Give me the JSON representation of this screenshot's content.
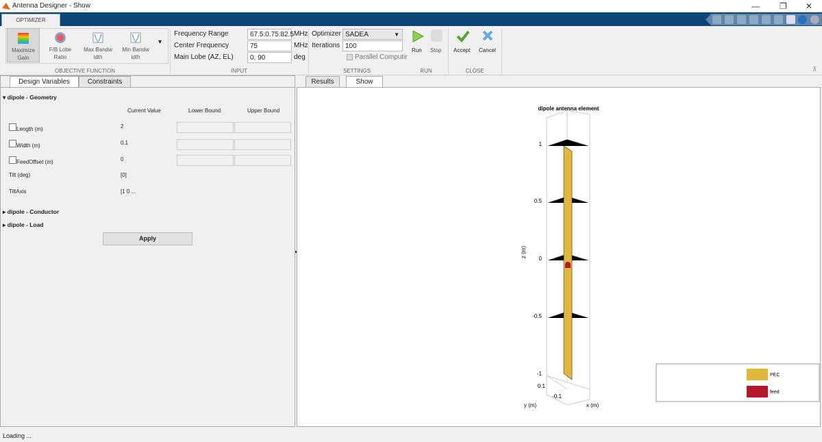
{
  "window": {
    "title": "Antenna Designer - Show",
    "minimize": "—",
    "restore": "❐",
    "close": "✕"
  },
  "ribbon": {
    "tab": "OPTIMIZER",
    "objective": {
      "label": "OBJECTIVE FUNCTION",
      "buttons": [
        {
          "l1": "Maximize",
          "l2": "Gain"
        },
        {
          "l1": "F/B Lobe",
          "l2": "Ratio"
        },
        {
          "l1": "Max Bandw",
          "l2": "idth"
        },
        {
          "l1": "Min Bandw",
          "l2": "idth"
        }
      ],
      "more": "▾"
    },
    "input": {
      "label": "INPUT",
      "freq_range_label": "Frequency Range",
      "freq_range": "67.5:0.75:82.5",
      "freq_unit": "MHz",
      "center_label": "Center Frequency",
      "center": "75",
      "center_unit": "MHz",
      "lobe_label": "Main Lobe (AZ, EL)",
      "lobe": "0, 90",
      "lobe_unit": "deg"
    },
    "settings": {
      "label": "SETTINGS",
      "optimizer_label": "Optimizer",
      "optimizer": "SADEA",
      "iterations_label": "Iterations",
      "iterations": "100",
      "parallel": "Parallel Computir"
    },
    "run": {
      "label": "RUN",
      "run": "Run",
      "stop": "Stop"
    },
    "close": {
      "label": "CLOSE",
      "accept": "Accept",
      "cancel": "Cancel"
    }
  },
  "left": {
    "tabs": [
      "Design Variables",
      "Constraints"
    ],
    "geometry": "dipole - Geometry",
    "cols": [
      "Current Value",
      "Lower Bound",
      "Upper Bound"
    ],
    "rows": [
      {
        "name": "Length (m)",
        "value": "2"
      },
      {
        "name": "Width (m)",
        "value": "0.1"
      },
      {
        "name": "FeedOffset (m)",
        "value": "0"
      }
    ],
    "fixed": [
      {
        "name": "Tilt (deg)",
        "value": "[0]"
      },
      {
        "name": "TiltAxis",
        "value": "[1  0 ..."
      }
    ],
    "conductor": "dipole - Conductor",
    "load": "dipole - Load",
    "apply": "Apply"
  },
  "right": {
    "tabs": [
      "Results",
      "Show"
    ],
    "plot": {
      "title": "dipole antenna element",
      "zlabel": "z (m)",
      "ylabel": "y (m)",
      "xlabel": "x (m)",
      "zticks": [
        "1",
        "0.5",
        "0",
        "-0.5",
        "-1"
      ],
      "yticks": [
        "0.1",
        "-0.1"
      ],
      "legend": [
        {
          "label": "PEC",
          "color": "#dfb83c"
        },
        {
          "label": "feed",
          "color": "#b5162c"
        }
      ]
    }
  },
  "status": "Loading ..."
}
